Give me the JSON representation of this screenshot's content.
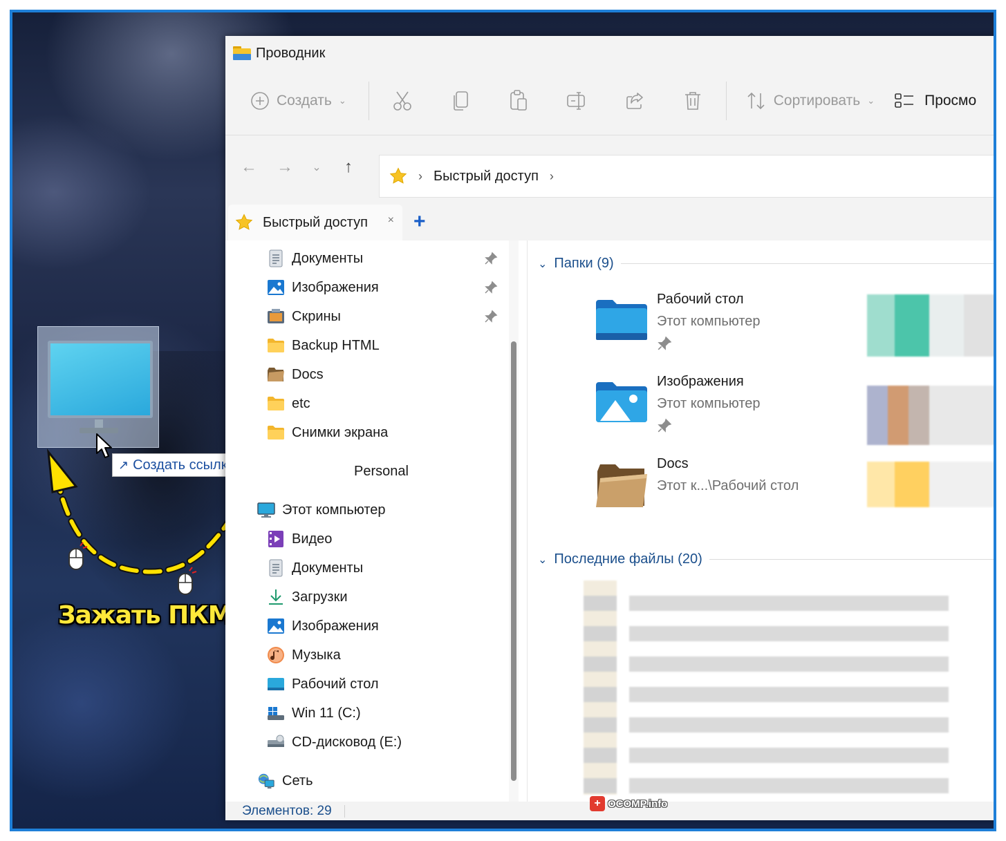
{
  "window": {
    "title": "Проводник"
  },
  "toolbar": {
    "create_label": "Создать",
    "sort_label": "Сортировать",
    "view_label": "Просмо"
  },
  "address": {
    "crumb": "Быстрый доступ"
  },
  "tab": {
    "label": "Быстрый доступ",
    "close": "×",
    "add": "+"
  },
  "sidebar": {
    "quick": [
      {
        "label": "Документы",
        "icon": "documents-icon",
        "pinned": true
      },
      {
        "label": "Изображения",
        "icon": "pictures-icon",
        "pinned": true
      },
      {
        "label": "Скрины",
        "icon": "screenshots-folder-icon",
        "pinned": true
      },
      {
        "label": "Backup HTML",
        "icon": "folder-icon",
        "pinned": false
      },
      {
        "label": "Docs",
        "icon": "brown-folder-icon",
        "pinned": false
      },
      {
        "label": "etc",
        "icon": "folder-icon",
        "pinned": false
      },
      {
        "label": "Снимки экрана",
        "icon": "folder-icon",
        "pinned": false
      }
    ],
    "personal": "Personal",
    "this_pc": "Этот компьютер",
    "pc_items": [
      {
        "label": "Видео",
        "icon": "video-icon"
      },
      {
        "label": "Документы",
        "icon": "documents-icon"
      },
      {
        "label": "Загрузки",
        "icon": "downloads-icon"
      },
      {
        "label": "Изображения",
        "icon": "pictures-icon"
      },
      {
        "label": "Музыка",
        "icon": "music-icon"
      },
      {
        "label": "Рабочий стол",
        "icon": "desktop-icon"
      },
      {
        "label": "Win 11 (C:)",
        "icon": "drive-icon"
      },
      {
        "label": "CD-дисковод (E:)",
        "icon": "cd-drive-icon"
      }
    ],
    "network": "Сеть"
  },
  "main": {
    "folders_group": "Папки (9)",
    "recent_group": "Последние файлы (20)",
    "folders": [
      {
        "name": "Рабочий стол",
        "location": "Этот компьютер",
        "pinned": true
      },
      {
        "name": "Изображения",
        "location": "Этот компьютер",
        "pinned": true
      },
      {
        "name": "Docs",
        "location": "Этот к...\\Рабочий стол",
        "pinned": false
      }
    ]
  },
  "status": {
    "items": "Элементов: 29"
  },
  "annotation": {
    "tooltip": "Создать ссылку в Рабочий стол",
    "hold_label": "Зажать ПКМ",
    "arrow_color": "#ffe100"
  },
  "watermark": {
    "text": "OCOMP.info",
    "badge": "+"
  },
  "colors": {
    "frame": "#1e7fd8",
    "accent": "#1a5fc8",
    "link_text": "#1b4f8c"
  }
}
